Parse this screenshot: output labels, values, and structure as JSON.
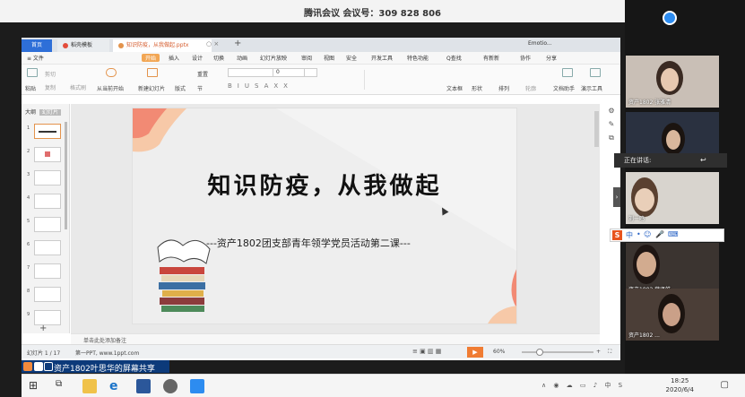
{
  "meeting": {
    "title": "腾讯会议 会议号：309 828 806"
  },
  "window_controls": [
    "—",
    "❐",
    "✕"
  ],
  "wps": {
    "tabs": {
      "home": "首页",
      "template": "稻壳模板",
      "doc": "知识防疫，从我做起.pptx",
      "account": "Emotio..."
    },
    "menu": [
      "≡ 文件",
      "开始",
      "插入",
      "设计",
      "切换",
      "动画",
      "幻灯片放映",
      "审阅",
      "视图",
      "安全",
      "开发工具",
      "特色功能",
      "Q查找",
      "有新新",
      "协作",
      "分享"
    ],
    "ribbon": [
      "粘贴",
      "剪切",
      "复制",
      "格式刷",
      "从当前开始",
      "新建幻灯片",
      "版式",
      "节",
      "重置",
      "文本框",
      "形状",
      "排列",
      "轮廓",
      "文档助手",
      "演示工具"
    ],
    "left_panel": {
      "outline": "大纲",
      "slides": "幻灯片",
      "numbers": [
        "1",
        "2",
        "3",
        "4",
        "5",
        "6",
        "7",
        "8",
        "9"
      ]
    },
    "slide": {
      "title": "知识防疫，从我做起",
      "subtitle": "---资产1802团支部青年领学党员活动第二课---"
    },
    "notes_placeholder": "单击此处添加备注",
    "status": {
      "slide_count": "幻灯片 1 / 17",
      "theme": "第一PPT, www.1ppt.com",
      "zoom": "60%"
    }
  },
  "share_banner": "资产1802叶思华的屏幕共享",
  "participants": {
    "speaking_label": "正在讲话:",
    "names": [
      "资产1802 张雅清",
      "刘一鸣",
      "资产1802 薛贤皓",
      "资产1802 ..."
    ]
  },
  "ime": {
    "s": "S",
    "items": [
      "中",
      "•",
      "☺",
      "🎤",
      "⌨"
    ]
  },
  "taskbar": {
    "time": "18:25",
    "date": "2020/6/4"
  },
  "colors": {
    "accent_orange": "#f2a654",
    "wps_blue": "#2e6fd8",
    "banner": "#0c3a7a",
    "coral": "#f28a74"
  }
}
